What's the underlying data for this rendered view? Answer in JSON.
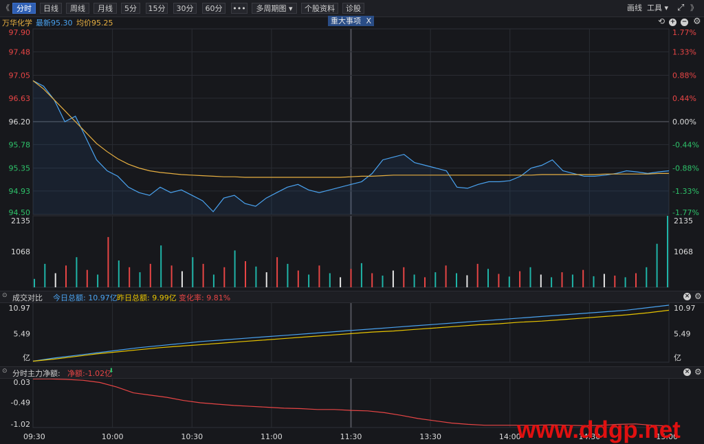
{
  "toolbar": {
    "collapse_label": "《",
    "tabs": [
      {
        "label": "分时",
        "active": true
      },
      {
        "label": "日线"
      },
      {
        "label": "周线"
      },
      {
        "label": "月线"
      },
      {
        "label": "5分"
      },
      {
        "label": "15分"
      },
      {
        "label": "30分"
      },
      {
        "label": "60分"
      },
      {
        "label": "•••"
      },
      {
        "label": "多周期图 ▾"
      },
      {
        "label": "个股资料"
      },
      {
        "label": "诊股"
      }
    ],
    "draw_label": "画线",
    "tools_label": "工具 ▾",
    "expand_label": "⤢",
    "collapse_right_label": "》"
  },
  "info": {
    "stock_name": "万华化学",
    "latest_label": "最新95.30",
    "avg_label": "均价95.25",
    "event_tag": "重大事项",
    "event_close": "X",
    "colors": {
      "name": "#e8b041",
      "latest": "#4aa3f0",
      "avg": "#e8b041"
    }
  },
  "turnover_panel": {
    "title": "成交对比",
    "today_label": "今日总额: 10.97亿",
    "yesterday_label": "昨日总额: 9.99亿",
    "change_label": "变化率: 9.81%"
  },
  "flow_panel": {
    "title": "分时主力净额:",
    "net_label": "净额:-1.02亿",
    "arrow": "⬇"
  },
  "watermark": "www.ddgp.net",
  "chart_data": [
    {
      "type": "line",
      "name": "price",
      "y_ticks_left": [
        "97.90",
        "97.48",
        "97.05",
        "96.63",
        "96.20",
        "95.78",
        "95.35",
        "94.93",
        "94.50"
      ],
      "y_ticks_right": [
        "1.77%",
        "1.33%",
        "0.88%",
        "0.44%",
        "0.00%",
        "-0.44%",
        "-0.88%",
        "-1.33%",
        "-1.77%"
      ],
      "ylim": [
        94.5,
        97.9
      ],
      "prev_close": 96.2,
      "x_ticks": [
        "09:30",
        "10:00",
        "10:30",
        "11:00",
        "11:30",
        "13:30",
        "14:00",
        "14:30",
        "15:00"
      ],
      "series": [
        {
          "name": "最新",
          "color": "#4aa3f0",
          "values": [
            96.95,
            96.85,
            96.6,
            96.2,
            96.3,
            95.9,
            95.5,
            95.3,
            95.2,
            95.0,
            94.9,
            94.85,
            95.0,
            94.9,
            94.95,
            94.85,
            94.75,
            94.55,
            94.8,
            94.85,
            94.7,
            94.65,
            94.8,
            94.9,
            95.0,
            95.05,
            94.95,
            94.9,
            94.95,
            95.0,
            95.05,
            95.1,
            95.25,
            95.5,
            95.55,
            95.6,
            95.45,
            95.4,
            95.35,
            95.3,
            95.0,
            94.98,
            95.05,
            95.1,
            95.1,
            95.12,
            95.2,
            95.35,
            95.4,
            95.5,
            95.3,
            95.25,
            95.2,
            95.2,
            95.22,
            95.25,
            95.3,
            95.28,
            95.25,
            95.28,
            95.3
          ]
        },
        {
          "name": "均价",
          "color": "#e8b041",
          "values": [
            96.95,
            96.8,
            96.6,
            96.4,
            96.2,
            96.0,
            95.8,
            95.65,
            95.52,
            95.42,
            95.35,
            95.3,
            95.27,
            95.25,
            95.23,
            95.22,
            95.21,
            95.2,
            95.19,
            95.19,
            95.18,
            95.18,
            95.18,
            95.18,
            95.18,
            95.18,
            95.18,
            95.18,
            95.18,
            95.18,
            95.19,
            95.2,
            95.2,
            95.21,
            95.22,
            95.22,
            95.22,
            95.22,
            95.22,
            95.22,
            95.22,
            95.22,
            95.22,
            95.22,
            95.22,
            95.22,
            95.22,
            95.22,
            95.23,
            95.23,
            95.23,
            95.23,
            95.23,
            95.23,
            95.24,
            95.24,
            95.24,
            95.24,
            95.24,
            95.25,
            95.25
          ]
        }
      ]
    },
    {
      "type": "bar",
      "name": "volume",
      "y_ticks": [
        "2135",
        "1068"
      ],
      "ylim": [
        0,
        2135
      ],
      "values": [
        250,
        700,
        420,
        650,
        900,
        520,
        380,
        1500,
        800,
        600,
        450,
        700,
        1250,
        650,
        480,
        900,
        700,
        380,
        600,
        1100,
        780,
        620,
        450,
        900,
        700,
        500,
        380,
        650,
        420,
        300,
        550,
        720,
        420,
        350,
        500,
        600,
        380,
        300,
        450,
        650,
        420,
        360,
        700,
        550,
        400,
        320,
        480,
        600,
        380,
        300,
        450,
        380,
        520,
        330,
        400,
        350,
        300,
        420,
        600,
        1300,
        2135
      ],
      "colors": [
        "g",
        "g",
        "w",
        "r",
        "g",
        "r",
        "g",
        "r",
        "g",
        "r",
        "g",
        "r",
        "g",
        "r",
        "w",
        "g",
        "r",
        "g",
        "r",
        "g",
        "r",
        "g",
        "w",
        "r",
        "g",
        "r",
        "g",
        "r",
        "g",
        "w",
        "r",
        "g",
        "r",
        "g",
        "w",
        "r",
        "g",
        "r",
        "g",
        "r",
        "g",
        "w",
        "r",
        "g",
        "r",
        "g",
        "r",
        "g",
        "w",
        "g",
        "r",
        "g",
        "r",
        "g",
        "w",
        "r",
        "g",
        "r",
        "g",
        "g",
        "g"
      ]
    },
    {
      "type": "line",
      "name": "turnover",
      "y_ticks": [
        "10.97",
        "5.49",
        "亿"
      ],
      "ylim": [
        0,
        10.97
      ],
      "series": [
        {
          "name": "今日总额",
          "color": "#4aa3f0",
          "values": [
            0.2,
            0.8,
            1.3,
            1.8,
            2.3,
            2.8,
            3.2,
            3.6,
            4.0,
            4.3,
            4.6,
            4.9,
            5.2,
            5.5,
            5.8,
            6.1,
            6.4,
            6.7,
            7.0,
            7.3,
            7.6,
            7.9,
            8.2,
            8.5,
            8.8,
            9.1,
            9.4,
            9.7,
            10.0,
            10.5,
            10.97
          ]
        },
        {
          "name": "昨日总额",
          "color": "#e8c400",
          "values": [
            0.2,
            0.6,
            1.1,
            1.6,
            2.0,
            2.4,
            2.8,
            3.1,
            3.4,
            3.7,
            4.0,
            4.3,
            4.6,
            4.9,
            5.2,
            5.5,
            5.8,
            6.0,
            6.3,
            6.6,
            6.9,
            7.2,
            7.4,
            7.7,
            7.9,
            8.2,
            8.5,
            8.8,
            9.1,
            9.5,
            9.99
          ]
        }
      ]
    },
    {
      "type": "line",
      "name": "main_net_flow",
      "y_ticks": [
        "0.03",
        "-0.49",
        "-1.02"
      ],
      "ylim": [
        -1.05,
        0.05
      ],
      "series": [
        {
          "name": "净额",
          "color": "#e84545",
          "values": [
            0.03,
            0.03,
            0.02,
            0.0,
            -0.05,
            -0.15,
            -0.28,
            -0.33,
            -0.38,
            -0.45,
            -0.5,
            -0.53,
            -0.56,
            -0.58,
            -0.6,
            -0.62,
            -0.63,
            -0.65,
            -0.65,
            -0.67,
            -0.68,
            -0.72,
            -0.78,
            -0.85,
            -0.9,
            -0.95,
            -0.98,
            -1.0,
            -1.0,
            -1.0,
            -1.0,
            -0.99,
            -1.0,
            -1.01,
            -1.0,
            -0.98,
            -0.97,
            -1.0,
            -1.02
          ]
        }
      ]
    }
  ]
}
